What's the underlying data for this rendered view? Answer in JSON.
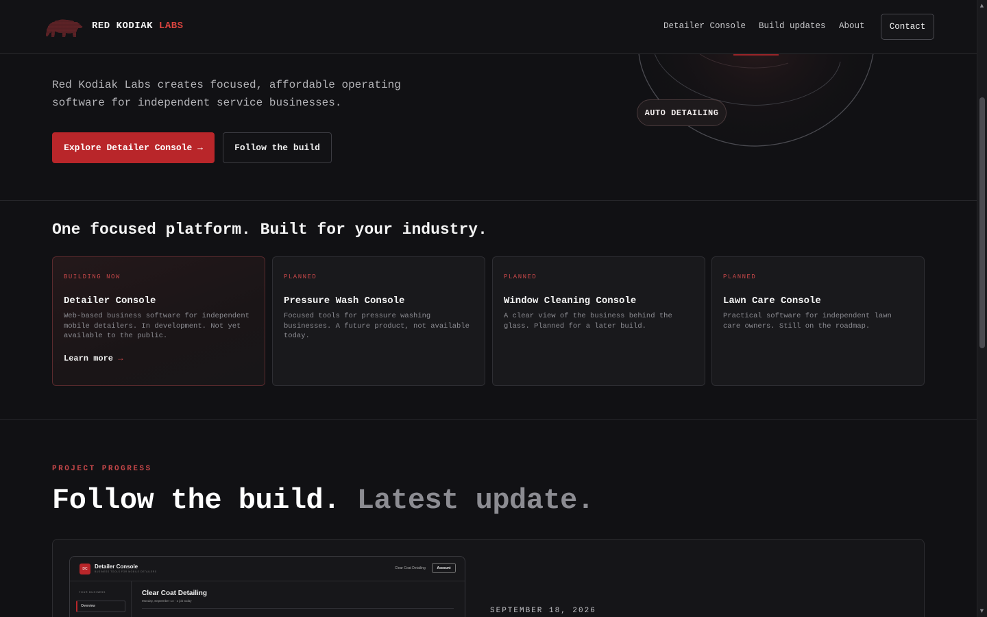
{
  "header": {
    "brand_main": "RED KODIAK",
    "brand_accent": "LABS",
    "nav": [
      "Detailer Console",
      "Build updates",
      "About"
    ],
    "contact_label": "Contact"
  },
  "hero": {
    "line1": "Red Kodiak Labs creates focused, affordable operating",
    "line2": "software for independent service businesses.",
    "primary_button": "Explore Detailer Console →",
    "secondary_button": "Follow the build",
    "pill_label": "AUTO DETAILING"
  },
  "platform": {
    "title": "One focused platform. Built for your industry.",
    "cards": [
      {
        "tag": "BUILDING NOW",
        "title": "Detailer Console",
        "description": "Web-based business software for independent mobile detailers. In development. Not yet available to the public.",
        "link_label": "Learn more",
        "link_arrow": "→"
      },
      {
        "tag": "PLANNED",
        "title": "Pressure Wash Console",
        "description": "Focused tools for pressure washing businesses. A future product, not available today."
      },
      {
        "tag": "PLANNED",
        "title": "Window Cleaning Console",
        "description": "A clear view of the business behind the glass. Planned for a later build."
      },
      {
        "tag": "PLANNED",
        "title": "Lawn Care Console",
        "description": "Practical software for independent lawn care owners. Still on the roadmap."
      }
    ]
  },
  "progress": {
    "kicker": "PROJECT PROGRESS",
    "title_main": "Follow the build.",
    "title_muted": "Latest update.",
    "date": "SEPTEMBER 18, 2026",
    "preview": {
      "logo_text": "DC",
      "app_name": "Detailer Console",
      "app_sub": "BUSINESS TOOLS FOR MOBILE DETAILERS",
      "business_name": "Clear Coat Detailing",
      "account_label": "Account",
      "sidebar_label": "YOUR BUSINESS",
      "sidebar_item": "Overview",
      "main_title": "Clear Coat Detailing",
      "main_date": "Monday, September 14 · 1 job today"
    }
  },
  "colors": {
    "accent": "#b9262a",
    "accent_text": "#d9443f",
    "background": "#111114"
  },
  "icons": [
    "bear-logo-icon",
    "arrow-right-icon",
    "scroll-up-icon",
    "scroll-down-icon"
  ]
}
